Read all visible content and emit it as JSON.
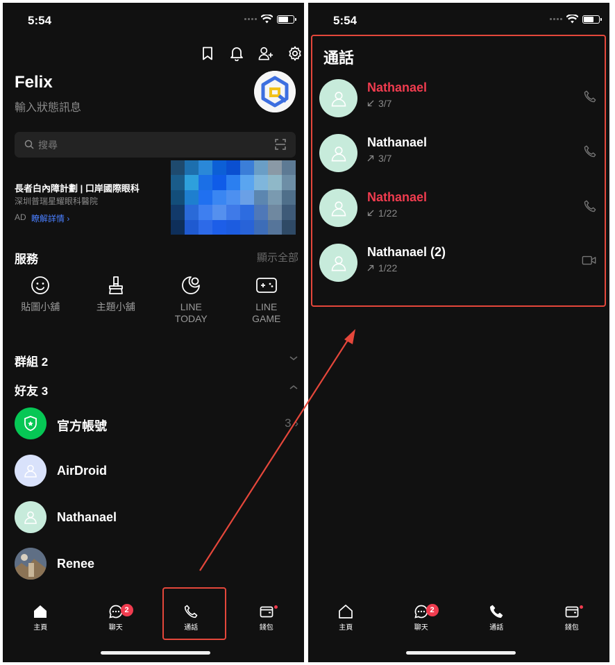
{
  "status_bar": {
    "time": "5:54"
  },
  "left": {
    "profile": {
      "name": "Felix",
      "status_placeholder": "輸入狀態訊息"
    },
    "search": {
      "placeholder": "搜尋"
    },
    "ad": {
      "title": "長者白內障計劃 | 口岸國際眼科",
      "subtitle": "深圳普瑞星耀眼科醫院",
      "tag": "AD",
      "link": "瞭解詳情 ›"
    },
    "services": {
      "heading": "服務",
      "show_all": "顯示全部",
      "items": [
        {
          "label": "貼圖小舖",
          "icon": "smiley-icon"
        },
        {
          "label": "主題小舖",
          "icon": "brush-icon"
        },
        {
          "label": "LINE\nTODAY",
          "icon": "moon-icon"
        },
        {
          "label": "LINE\nGAME",
          "icon": "gamepad-icon"
        }
      ]
    },
    "groups": {
      "heading": "群組 2"
    },
    "friends": {
      "heading": "好友 3",
      "items": [
        {
          "name": "官方帳號",
          "count": "3 ›"
        },
        {
          "name": "AirDroid"
        },
        {
          "name": "Nathanael"
        },
        {
          "name": "Renee"
        }
      ]
    }
  },
  "right": {
    "title": "通話",
    "calls": [
      {
        "name": "Nathanael",
        "date": "3/7",
        "direction": "incoming",
        "missed": true,
        "type": "voice"
      },
      {
        "name": "Nathanael",
        "date": "3/7",
        "direction": "outgoing",
        "missed": false,
        "type": "voice"
      },
      {
        "name": "Nathanael",
        "date": "1/22",
        "direction": "incoming",
        "missed": true,
        "type": "voice"
      },
      {
        "name": "Nathanael (2)",
        "date": "1/22",
        "direction": "outgoing",
        "missed": false,
        "type": "video"
      }
    ]
  },
  "tabbar": {
    "tabs": [
      {
        "label": "主頁",
        "icon": "home-icon"
      },
      {
        "label": "聊天",
        "icon": "chat-icon",
        "badge": "2"
      },
      {
        "label": "通話",
        "icon": "phone-icon"
      },
      {
        "label": "錢包",
        "icon": "wallet-icon"
      }
    ]
  },
  "colors": {
    "background": "#111111",
    "missed_call": "#f03c4f",
    "link": "#4a7fff",
    "annotation": "#e5473b",
    "avatar_mint": "#c7ebdb",
    "official_green": "#06c755"
  }
}
